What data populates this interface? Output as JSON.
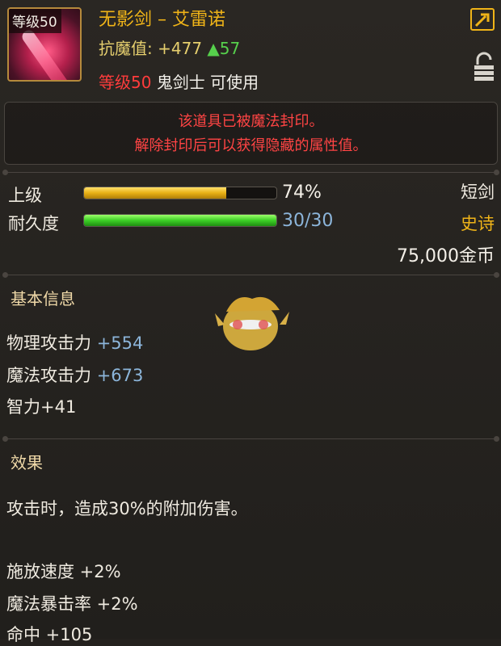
{
  "item": {
    "icon_name": "sword-icon",
    "icon_level": "等级50",
    "title": "无影剑 – 艾雷诺",
    "resist_label": "抗魔值:",
    "resist_value": "+477",
    "resist_increase": "▲57",
    "req_level": "等级50",
    "req_class": "鬼剑士",
    "req_usable": "可使用"
  },
  "seal": {
    "line1": "该道具已被魔法封印。",
    "line2": "解除封印后可以获得隐藏的属性值。"
  },
  "grade": {
    "label": "上级",
    "value_text": "74%",
    "fraction": 0.74
  },
  "durability": {
    "label": "耐久度",
    "value_text": "30/30",
    "fraction": 1.0
  },
  "meta": {
    "type": "短剑",
    "rarity": "史诗",
    "price": "75,000金币"
  },
  "basic": {
    "heading": "基本信息",
    "stats": [
      {
        "name": "物理攻击力",
        "value": "+554"
      },
      {
        "name": "魔法攻击力",
        "value": "+673"
      },
      {
        "name": "智力+41",
        "value": ""
      }
    ]
  },
  "effect": {
    "heading": "效果",
    "description": "攻击时，造成30%的附加伤害。",
    "stats": [
      "施放速度 +2%",
      "魔法暴击率 +2%",
      "命中 +105"
    ]
  },
  "colors": {
    "gold": "#f0b418",
    "red": "#ff4444",
    "green": "#56d04c",
    "blue": "#8cb5da"
  }
}
